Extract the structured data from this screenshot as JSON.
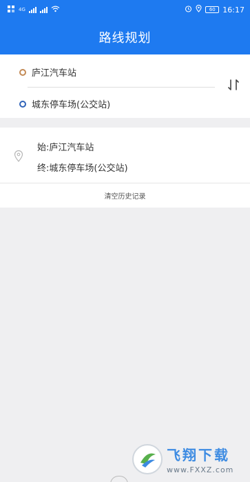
{
  "status_bar": {
    "time": "16:17",
    "battery": "60",
    "network_tag": "4G"
  },
  "header": {
    "title": "路线规划"
  },
  "route": {
    "start": "庐江汽车站",
    "end": "城东停车场(公交站)"
  },
  "history": {
    "items": [
      {
        "start_label": "始:庐江汽车站",
        "end_label": "终:城东停车场(公交站)"
      }
    ],
    "clear_label": "清空历史记录"
  },
  "watermark": {
    "text": "飞翔下载",
    "url": "www.FXXZ.com"
  },
  "colors": {
    "primary": "#1e7af0",
    "start_dot": "#c38a55",
    "end_dot": "#2f63b8",
    "background": "#efeff1"
  },
  "icons": [
    "wifi-icon",
    "signal-icon",
    "alarm-icon",
    "location-icon",
    "battery-icon",
    "swap-icon",
    "map-pin-icon"
  ]
}
